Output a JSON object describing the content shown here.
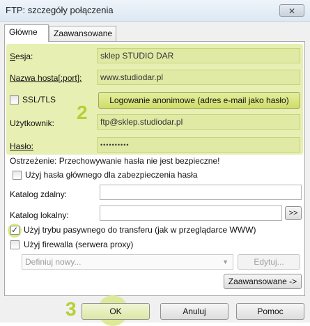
{
  "window": {
    "title": "FTP: szczegóły połączenia",
    "close_glyph": "✕"
  },
  "tabs": [
    {
      "label": "Główne",
      "active": true
    },
    {
      "label": "Zaawansowane",
      "active": false
    }
  ],
  "form": {
    "session": {
      "label": "Sesja:",
      "value": "sklep STUDIO DAR"
    },
    "host": {
      "label": "Nazwa hosta[:port]:",
      "value": "www.studiodar.pl"
    },
    "ssl": {
      "label": "SSL/TLS",
      "checked": false
    },
    "anonymous_button": "Logowanie anonimowe (adres e-mail jako hasło)",
    "user": {
      "label": "Użytkownik:",
      "value": "ftp@sklep.studiodar.pl"
    },
    "password": {
      "label": "Hasło:",
      "value": "••••••••••"
    },
    "warning": "Ostrzeżenie: Przechowywanie hasła nie jest bezpieczne!",
    "master_password": {
      "label": "Użyj hasła głównego dla zabezpieczenia hasła",
      "checked": false
    },
    "remote_dir": {
      "label": "Katalog zdalny:",
      "value": ""
    },
    "local_dir": {
      "label": "Katalog lokalny:",
      "value": "",
      "browse_label": ">>"
    },
    "passive": {
      "label": "Użyj trybu pasywnego do transferu (jak w przeglądarce WWW)",
      "checked": true
    },
    "firewall": {
      "label": "Użyj firewalla (serwera proxy)",
      "checked": false
    },
    "proxy_select": {
      "value": "Definiuj nowy..."
    },
    "edit_button": "Edytuj...",
    "advanced_button": "Zaawansowane ->"
  },
  "footer": {
    "ok": "OK",
    "cancel": "Anuluj",
    "help": "Pomoc"
  },
  "annotations": {
    "step2": "2",
    "step3": "3"
  },
  "colors": {
    "highlight": "#e7efb3",
    "step_number": "#b7cf33",
    "dialog_bg": "#f0f0f0"
  }
}
